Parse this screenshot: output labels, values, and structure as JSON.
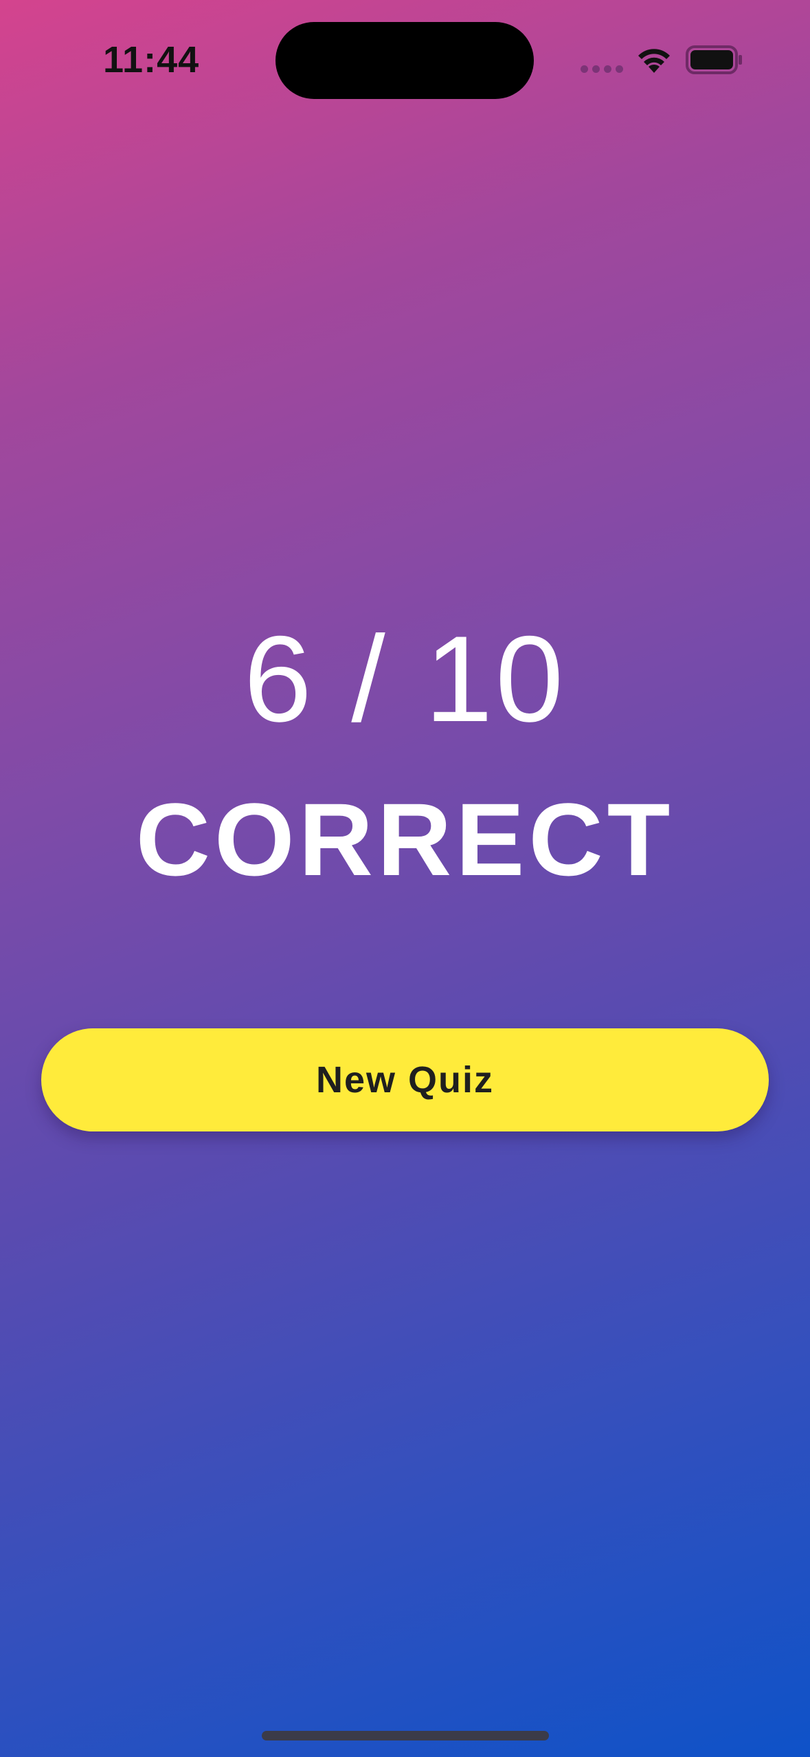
{
  "status_bar": {
    "time": "11:44",
    "icons": [
      "cellular-signal-icon",
      "wifi-icon",
      "battery-icon"
    ]
  },
  "result": {
    "score": "6 / 10",
    "label": "CORRECT"
  },
  "actions": {
    "new_quiz_label": "New Quiz"
  },
  "colors": {
    "gradient_start": "#d4448e",
    "gradient_end": "#0e52c8",
    "button_background": "#ffeb3b",
    "button_text": "#1f1f1f",
    "text": "#ffffff"
  }
}
